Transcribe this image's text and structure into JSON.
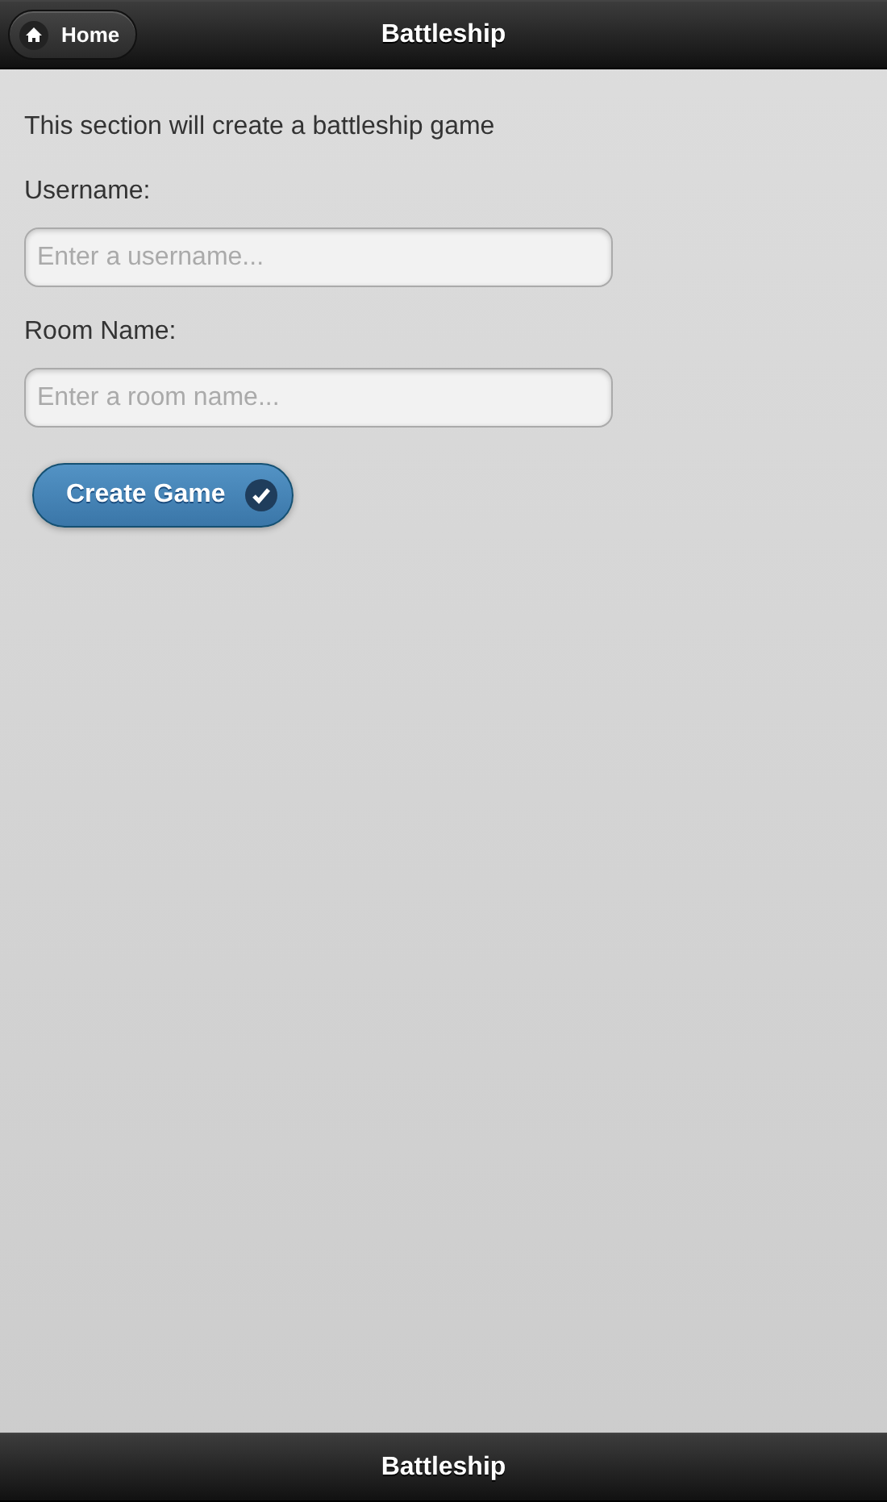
{
  "header": {
    "title": "Battleship",
    "home_button": "Home"
  },
  "intro": "This section will create a battleship game",
  "fields": [
    {
      "label": "Username:",
      "placeholder": "Enter a username..."
    },
    {
      "label": "Room Name:",
      "placeholder": "Enter a room name..."
    }
  ],
  "submit_button": "Create Game",
  "footer": {
    "title": "Battleship"
  }
}
